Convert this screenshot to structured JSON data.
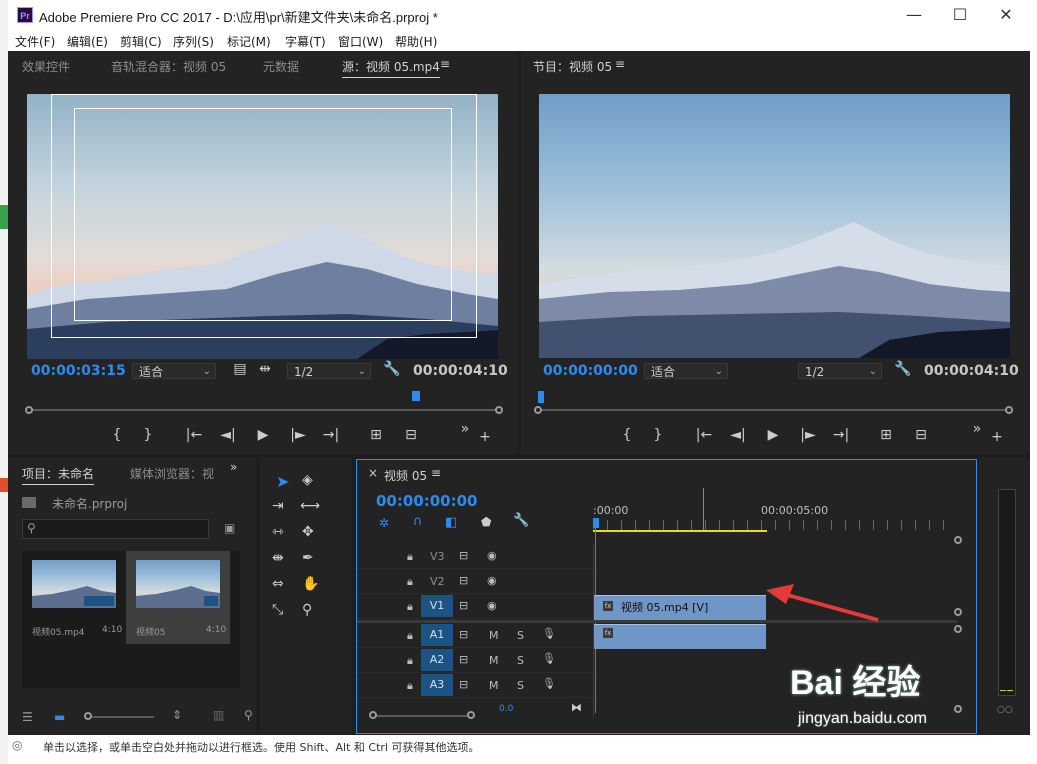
{
  "window": {
    "logo_text": "Pr",
    "title": "Adobe Premiere Pro CC 2017 - D:\\应用\\pr\\新建文件夹\\未命名.prproj *",
    "minimize": "—",
    "maximize": "☐",
    "close": "✕"
  },
  "menu": [
    "文件(F)",
    "编辑(E)",
    "剪辑(C)",
    "序列(S)",
    "标记(M)",
    "字幕(T)",
    "窗口(W)",
    "帮助(H)"
  ],
  "source_panel": {
    "tabs": [
      "效果控件",
      "音轨混合器：视频 05",
      "元数据",
      "源：视频 05.mp4"
    ],
    "menu_icon": "≡",
    "timecode_in": "00:00:03:15",
    "fit": "适合",
    "resolution": "1/2",
    "timecode_dur": "00:00:04:10",
    "playhead_fraction": 0.82
  },
  "program_panel": {
    "tab": "节目：视频 05",
    "menu_icon": "≡",
    "timecode_in": "00:00:00:00",
    "fit": "适合",
    "resolution": "1/2",
    "timecode_dur": "00:00:04:10",
    "playhead_fraction": 0.0
  },
  "controls": {
    "mark_in": "{",
    "mark_out": "}",
    "goto_in": "|←",
    "step_back": "◄|",
    "play": "▶",
    "step_fwd": "|►",
    "goto_out": "→|",
    "more": "»",
    "add": "+"
  },
  "project_panel": {
    "tabs": [
      "项目：未命名",
      "媒体浏览器：视"
    ],
    "more": "»",
    "file": "未命名.prproj",
    "items": [
      {
        "name": "视频05.mp4",
        "duration": "4:10"
      },
      {
        "name": "视频05",
        "duration": "4:10"
      }
    ]
  },
  "timeline": {
    "close": "×",
    "tab": "视频 05",
    "menu_icon": "≡",
    "timecode": "00:00:00:00",
    "ruler": [
      ":00:00",
      "00:00:05:00"
    ],
    "tracks": [
      {
        "name": "V3",
        "highlighted": false
      },
      {
        "name": "V2",
        "highlighted": false
      },
      {
        "name": "V1",
        "highlighted": true
      },
      {
        "name": "A1",
        "highlighted": true
      },
      {
        "name": "A2",
        "highlighted": true
      },
      {
        "name": "A3",
        "highlighted": true
      }
    ],
    "video_clip": "视频 05.mp4 [V]",
    "audio_clip_icon": "fx",
    "scroll_value": "0.0",
    "mute": "M",
    "solo": "S"
  },
  "status": {
    "text": "单击以选择，或单击空白处并拖动以进行框选。使用 Shift、Alt 和 Ctrl 可获得其他选项。"
  },
  "watermark": {
    "brand": "Bai  经验",
    "url": "jingyan.baidu.com"
  },
  "colors": {
    "accent_blue": "#2d8ceb",
    "track_blue": "#1d5383",
    "clip_blue": "#7096c8",
    "arrow_red": "#e63a3a"
  }
}
